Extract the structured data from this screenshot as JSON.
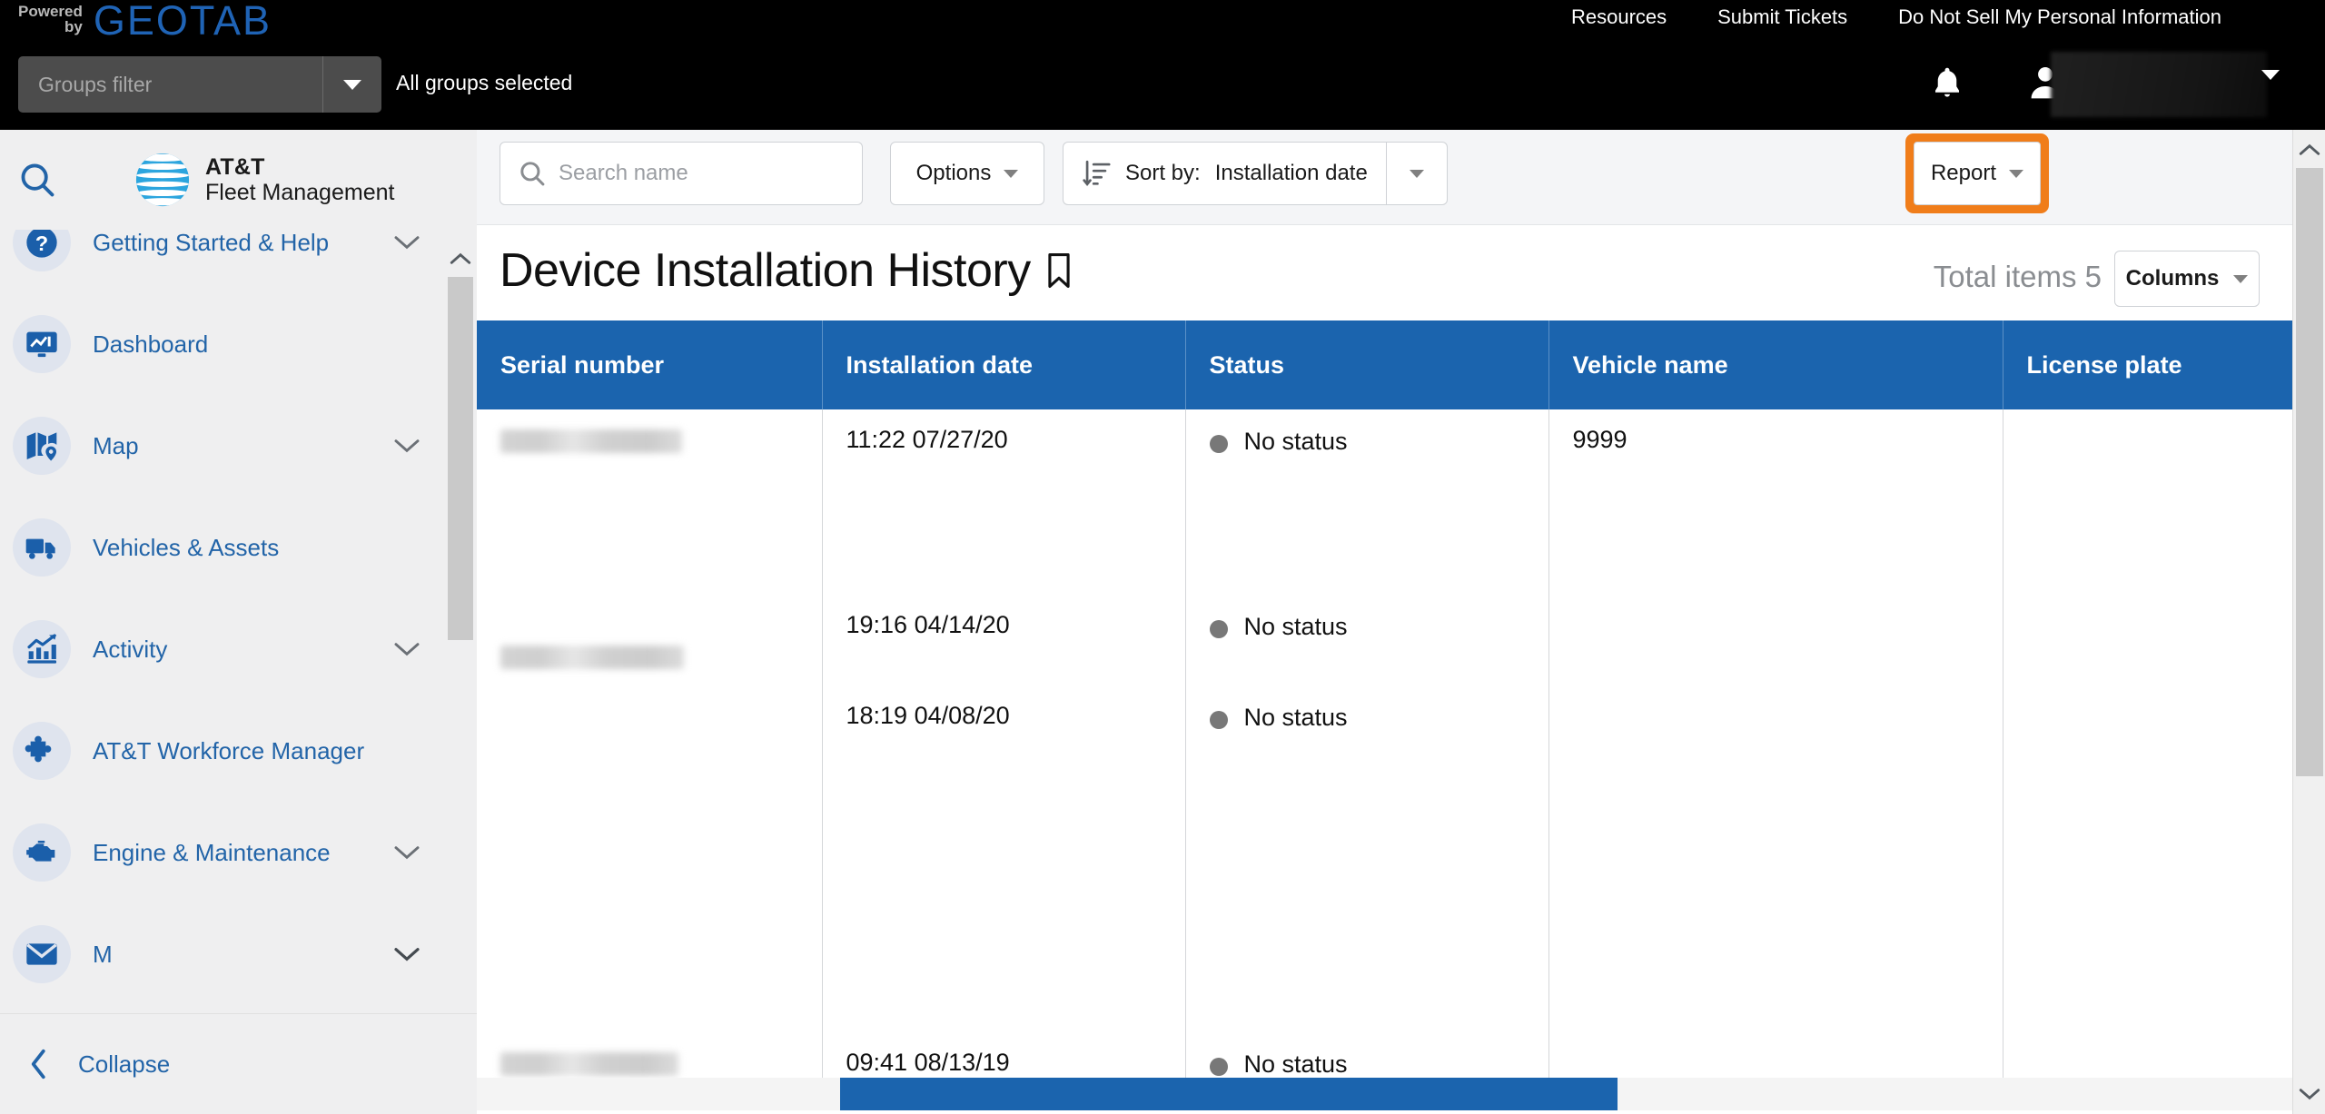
{
  "topbar": {
    "powered_line1": "Powered",
    "powered_line2": "by",
    "brand": "GEOTAB",
    "nav": [
      {
        "label": "Resources"
      },
      {
        "label": "Submit Tickets"
      },
      {
        "label": "Do Not Sell My Personal Information"
      }
    ],
    "groups_filter_placeholder": "Groups filter",
    "groups_status": "All groups selected",
    "notifications_icon": "bell-icon",
    "account_icon": "person-icon",
    "account_name": ""
  },
  "sidebar": {
    "search_icon": "search-icon",
    "logo_line1": "AT&T",
    "logo_line2": "Fleet Management",
    "items": [
      {
        "label": "Getting Started & Help",
        "icon": "question-mark-icon",
        "expandable": true
      },
      {
        "label": "Dashboard",
        "icon": "monitor-chart-icon",
        "expandable": false
      },
      {
        "label": "Map",
        "icon": "map-pin-icon",
        "expandable": true
      },
      {
        "label": "Vehicles & Assets",
        "icon": "truck-icon",
        "expandable": false
      },
      {
        "label": "Activity",
        "icon": "bar-chart-arrow-icon",
        "expandable": true
      },
      {
        "label": "AT&T Workforce Manager",
        "icon": "puzzle-piece-icon",
        "expandable": false
      },
      {
        "label": "Engine & Maintenance",
        "icon": "engine-icon",
        "expandable": true
      },
      {
        "label": "M",
        "icon": "envelope-icon",
        "expandable": true
      }
    ],
    "collapse_label": "Collapse",
    "collapse_icon": "chevron-left-icon"
  },
  "toolbar": {
    "search_placeholder": "Search name",
    "search_value": "",
    "search_icon": "search-icon",
    "options_label": "Options",
    "sort_icon": "sort-descending-icon",
    "sort_label": "Sort by:",
    "sort_value": "Installation date",
    "report_label": "Report",
    "report_highlighted": true,
    "highlight_color": "#f07d1a"
  },
  "page": {
    "title": "Device Installation History",
    "bookmark_icon": "bookmark-icon",
    "total_items_label": "Total items 5",
    "columns_label": "Columns"
  },
  "table": {
    "columns": [
      "Serial number",
      "Installation date",
      "Status",
      "Vehicle name",
      "License plate"
    ],
    "rows": [
      {
        "serial_number": "",
        "serial_redacted": true,
        "installation_date": "11:22 07/27/20",
        "status": "No status",
        "vehicle_name": "9999",
        "license_plate": ""
      },
      {
        "serial_number": "",
        "serial_redacted": true,
        "installation_date": "19:16 04/14/20",
        "status": "No status",
        "vehicle_name": "",
        "license_plate": ""
      },
      {
        "serial_number": "",
        "serial_redacted": true,
        "installation_date": "18:19 04/08/20",
        "status": "No status",
        "vehicle_name": "",
        "license_plate": ""
      },
      {
        "serial_number": "",
        "serial_redacted": true,
        "installation_date": "09:41 08/13/19",
        "status": "No status",
        "vehicle_name": "",
        "license_plate": ""
      }
    ],
    "header_color": "#1b64ae",
    "status_dot_color": "#787878"
  },
  "scrollbars": {
    "vertical_up_icon": "chevron-up-icon",
    "vertical_down_icon": "chevron-down-icon",
    "horizontal_color": "#1b64ae"
  }
}
